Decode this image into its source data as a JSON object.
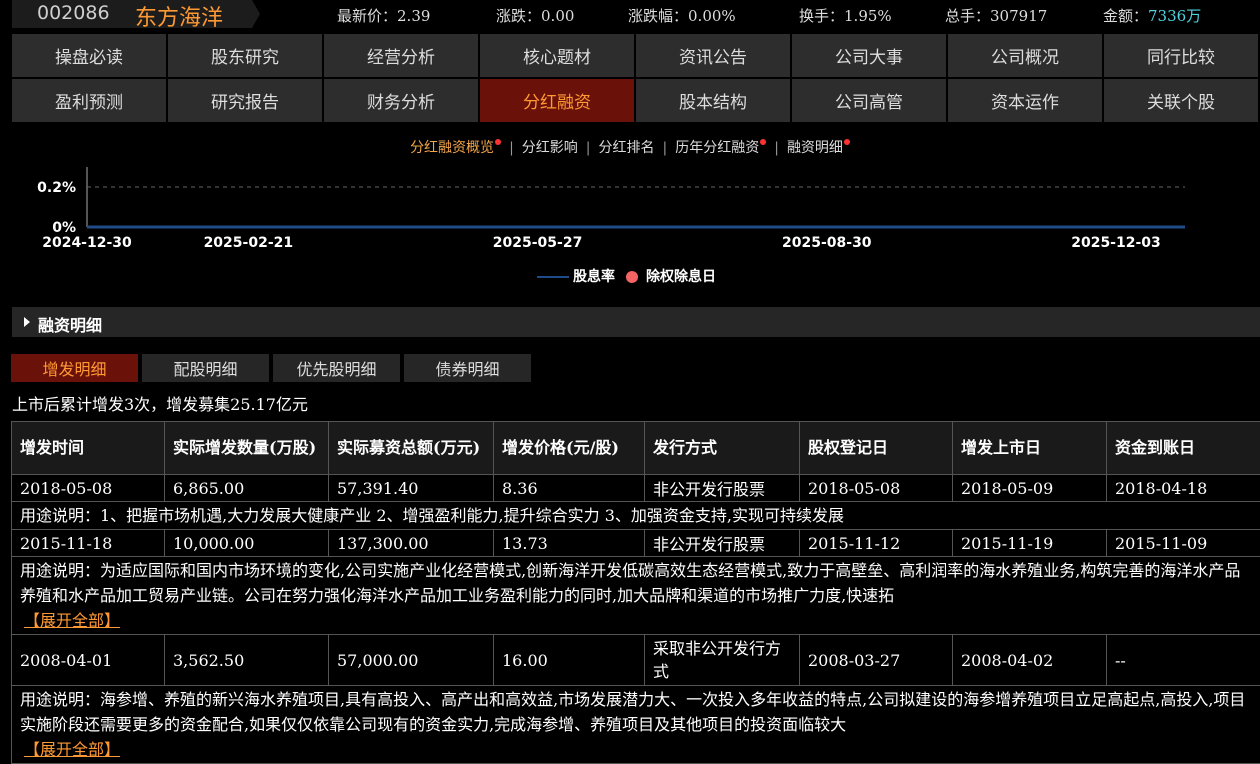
{
  "header": {
    "code": "002086",
    "name": "东方海洋",
    "quotes": [
      {
        "label": "最新价：",
        "value": "2.39",
        "accent": false
      },
      {
        "label": "涨跌：",
        "value": "0.00",
        "accent": false
      },
      {
        "label": "涨跌幅：",
        "value": "0.00%",
        "accent": false
      },
      {
        "label": "换手：",
        "value": "1.95%",
        "accent": false
      },
      {
        "label": "总手：",
        "value": "307917",
        "accent": false
      },
      {
        "label": "金额：",
        "value": "7336万",
        "accent": true
      }
    ]
  },
  "nav": {
    "row1": [
      "操盘必读",
      "股东研究",
      "经营分析",
      "核心题材",
      "资讯公告",
      "公司大事",
      "公司概况",
      "同行比较"
    ],
    "row2": [
      "盈利预测",
      "研究报告",
      "财务分析",
      "分红融资",
      "股本结构",
      "公司高管",
      "资本运作",
      "关联个股"
    ],
    "active": "分红融资"
  },
  "subtabs": [
    {
      "label": "分红融资概览",
      "dot": true,
      "active": true
    },
    {
      "label": "分红影响",
      "dot": false,
      "active": false
    },
    {
      "label": "分红排名",
      "dot": false,
      "active": false
    },
    {
      "label": "历年分红融资",
      "dot": true,
      "active": false
    },
    {
      "label": "融资明细",
      "dot": true,
      "active": false
    }
  ],
  "chart_data": {
    "type": "line",
    "y_ticks": [
      "0%",
      "0.2%"
    ],
    "ylim": [
      0,
      0.2
    ],
    "x_ticks": [
      "2024-12-30",
      "2025-02-21",
      "2025-05-27",
      "2025-08-30",
      "2025-12-03"
    ],
    "series": [
      {
        "name": "股息率",
        "values": [
          0,
          0,
          0,
          0,
          0
        ]
      }
    ],
    "legend": [
      "股息率",
      "除权除息日"
    ],
    "legend_position": "bottom",
    "colors": {
      "line": "#1f4b87",
      "marker": "#f46464",
      "grid": "#666666"
    }
  },
  "section": {
    "title": "融资明细"
  },
  "tabs": [
    {
      "label": "增发明细",
      "active": true
    },
    {
      "label": "配股明细",
      "active": false
    },
    {
      "label": "优先股明细",
      "active": false
    },
    {
      "label": "债券明细",
      "active": false
    }
  ],
  "summary": "上市后累计增发3次，增发募集25.17亿元",
  "table": {
    "headers": [
      "增发时间",
      "实际增发数量(万股)",
      "实际募资总额(万元)",
      "增发价格(元/股)",
      "发行方式",
      "股权登记日",
      "增发上市日",
      "资金到账日"
    ],
    "expand_label": "【展开全部】",
    "rows": [
      {
        "cells": [
          "2018-05-08",
          "6,865.00",
          "57,391.40",
          "8.36",
          "非公开发行股票",
          "2018-05-08",
          "2018-05-09",
          "2018-04-18"
        ],
        "use": "用途说明：1、把握市场机遇,大力发展大健康产业 2、增强盈利能力,提升综合实力 3、加强资金支持,实现可持续发展",
        "expand": false
      },
      {
        "cells": [
          "2015-11-18",
          "10,000.00",
          "137,300.00",
          "13.73",
          "非公开发行股票",
          "2015-11-12",
          "2015-11-19",
          "2015-11-09"
        ],
        "use": "用途说明：为适应国际和国内市场环境的变化,公司实施产业化经营模式,创新海洋开发低碳高效生态经营模式,致力于高壁垒、高利润率的海水养殖业务,构筑完善的海洋水产品养殖和水产品加工贸易产业链。公司在努力强化海洋水产品加工业务盈利能力的同时,加大品牌和渠道的市场推广力度,快速拓",
        "expand": true
      },
      {
        "cells": [
          "2008-04-01",
          "3,562.50",
          "57,000.00",
          "16.00",
          "采取非公开发行方式",
          "2008-03-27",
          "2008-04-02",
          "--"
        ],
        "use": "用途说明：海参增、养殖的新兴海水养殖项目,具有高投入、高产出和高效益,市场发展潜力大、一次投入多年收益的特点,公司拟建设的海参增养殖项目立足高起点,高投入,项目实施阶段还需要更多的资金配合,如果仅仅依靠公司现有的资金实力,完成海参增、养殖项目及其他项目的投资面临较大",
        "expand": true
      }
    ]
  }
}
